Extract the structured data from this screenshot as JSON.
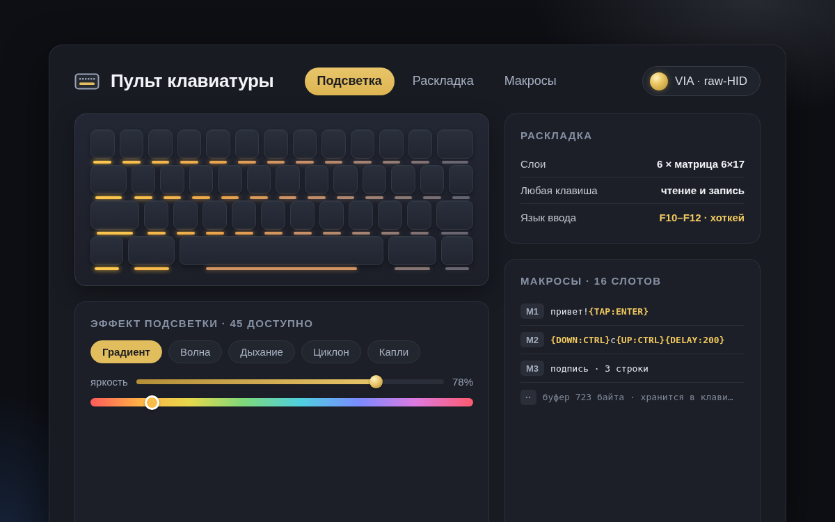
{
  "header": {
    "title": "Пульт клавиатуры",
    "tabs": [
      {
        "label": "Подсветка",
        "selected": true
      },
      {
        "label": "Раскладка",
        "selected": false
      },
      {
        "label": "Макросы",
        "selected": false
      }
    ],
    "connection": {
      "label": "VIA · raw-HID"
    }
  },
  "effects": {
    "title": "ЭФФЕКТ ПОДСВЕТКИ · 45 ДОСТУПНО",
    "options": [
      {
        "label": "Градиент",
        "selected": true
      },
      {
        "label": "Волна",
        "selected": false
      },
      {
        "label": "Дыхание",
        "selected": false
      },
      {
        "label": "Циклон",
        "selected": false
      },
      {
        "label": "Капли",
        "selected": false
      }
    ],
    "brightness": {
      "label": "яркость",
      "level": 0.78,
      "reading": "78%"
    },
    "hue": {
      "level": 0.16
    }
  },
  "layout": {
    "title": "РАСКЛАДКА",
    "rows": [
      {
        "label": "Слои",
        "value": "6 × матрица 6×17",
        "highlighted": false
      },
      {
        "label": "Любая клавиша",
        "value": "чтение и запись",
        "highlighted": false
      },
      {
        "label": "Язык ввода",
        "value": "F10–F12 · хоткей",
        "highlighted": true
      }
    ]
  },
  "macros": {
    "title": "МАКРОСЫ · 16 СЛОТОВ",
    "rows": [
      {
        "kind": "macro",
        "slot": "M1",
        "text": "привет!**{TAP:ENTER}**"
      },
      {
        "kind": "macro",
        "slot": "M2",
        "text": "**{DOWN:CTRL}**c**{UP:CTRL}{DELAY:200}**"
      },
      {
        "kind": "macro",
        "slot": "M3",
        "text": "подпись · 3 строки"
      },
      {
        "kind": "note",
        "slot": "··",
        "text": "буфер 723 байта · хранится в клави…"
      }
    ]
  }
}
